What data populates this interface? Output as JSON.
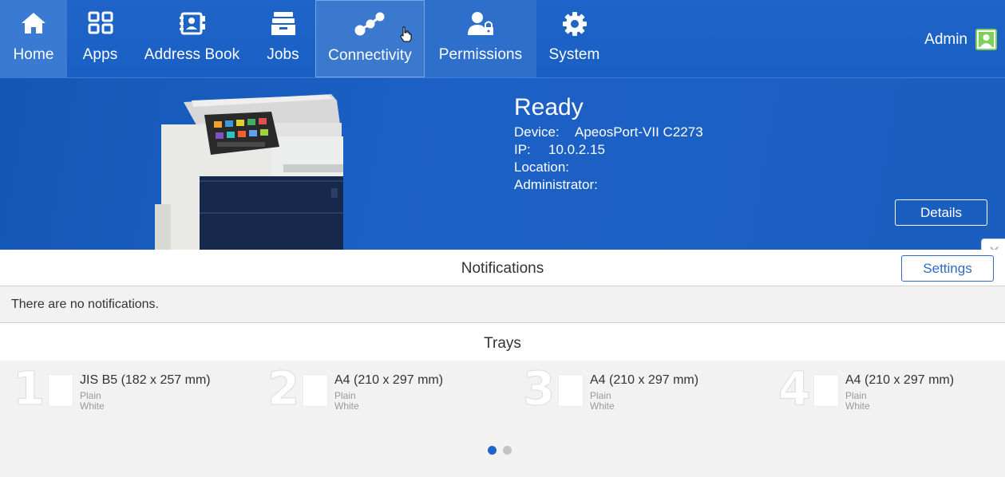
{
  "nav": {
    "items": [
      {
        "label": "Home",
        "icon": "home-icon"
      },
      {
        "label": "Apps",
        "icon": "apps-grid-icon"
      },
      {
        "label": "Address Book",
        "icon": "address-book-icon"
      },
      {
        "label": "Jobs",
        "icon": "jobs-stack-icon"
      },
      {
        "label": "Connectivity",
        "icon": "connectivity-icon"
      },
      {
        "label": "Permissions",
        "icon": "permissions-lock-user-icon"
      },
      {
        "label": "System",
        "icon": "gear-icon"
      }
    ],
    "active_color": "#3a7ad2"
  },
  "user": {
    "name": "Admin",
    "avatar_color": "#7ed05a"
  },
  "device": {
    "status": "Ready",
    "device_label": "Device:",
    "device_value": "ApeosPort-VII C2273",
    "ip_label": "IP:",
    "ip_value": "10.0.2.15",
    "location_label": "Location:",
    "location_value": "",
    "admin_label": "Administrator:",
    "admin_value": "",
    "details_label": "Details"
  },
  "notifications": {
    "title": "Notifications",
    "settings_label": "Settings",
    "message": "There are no notifications."
  },
  "trays": {
    "title": "Trays",
    "items": [
      {
        "number": "1",
        "size": "JIS B5 (182 x 257 mm)",
        "type": "Plain",
        "color": "White"
      },
      {
        "number": "2",
        "size": "A4 (210 x 297 mm)",
        "type": "Plain",
        "color": "White"
      },
      {
        "number": "3",
        "size": "A4 (210 x 297 mm)",
        "type": "Plain",
        "color": "White"
      },
      {
        "number": "4",
        "size": "A4 (210 x 297 mm)",
        "type": "Plain",
        "color": "White"
      }
    ],
    "pager": {
      "pages": 2,
      "current": 1
    }
  },
  "colors": {
    "brand_blue": "#1a5fc3",
    "accent_outline": "#2f6ac8",
    "dot_active": "#1f65c8",
    "dot_inactive": "#c4c4c4"
  }
}
